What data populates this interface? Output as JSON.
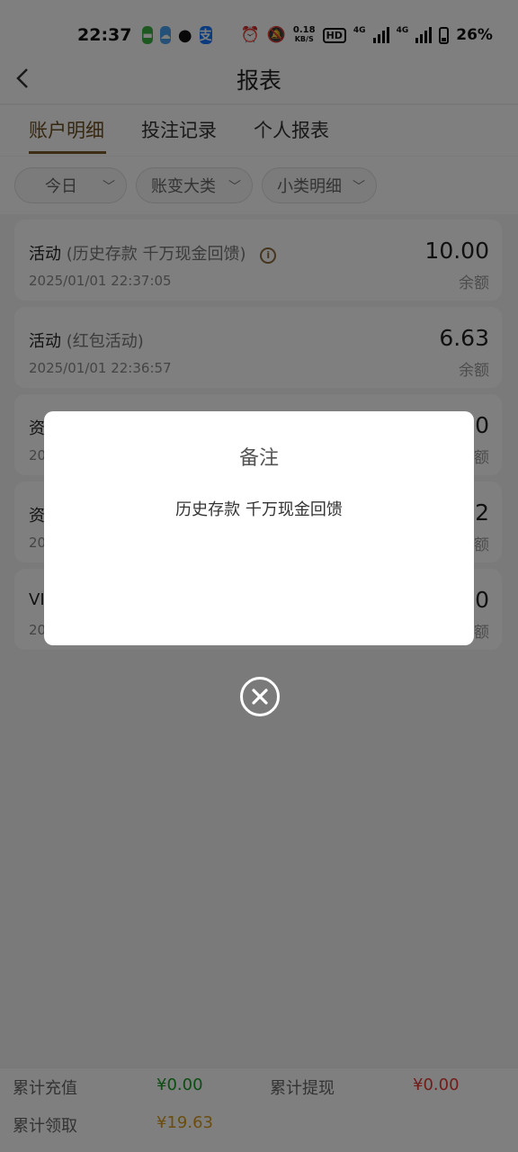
{
  "status_bar": {
    "time": "22:37",
    "net_speed_value": "0.18",
    "net_speed_unit": "KB/S",
    "hd_label": "HD",
    "network1": "4G",
    "network2": "4G",
    "battery": "26%",
    "icons": [
      "message-app-icon",
      "weather-app-icon",
      "wechat-icon",
      "alipay-icon",
      "alarm-icon",
      "mute-icon",
      "signal-icon",
      "battery-icon"
    ]
  },
  "nav": {
    "back_icon": "chevron-left-icon",
    "title": "报表"
  },
  "tabs": [
    {
      "label": "账户明细",
      "active": true
    },
    {
      "label": "投注记录",
      "active": false
    },
    {
      "label": "个人报表",
      "active": false
    }
  ],
  "filters": [
    {
      "label": "今日"
    },
    {
      "label": "账变大类"
    },
    {
      "label": "小类明细"
    }
  ],
  "records": [
    {
      "title": "活动",
      "sub": "(历史存款 千万现金回馈)",
      "has_info": true,
      "time": "2025/01/01 22:37:05",
      "amount": "10.00",
      "balance_label": "余额"
    },
    {
      "title": "活动",
      "sub": "(红包活动)",
      "has_info": false,
      "time": "2025/01/01 22:36:57",
      "amount": "6.63",
      "balance_label": "余额"
    },
    {
      "title": "资",
      "sub": "",
      "has_info": false,
      "time": "20",
      "amount": "0",
      "balance_label": "额"
    },
    {
      "title": "资",
      "sub": "",
      "has_info": false,
      "time": "20",
      "amount": "2",
      "balance_label": "额"
    },
    {
      "title": "VI",
      "sub": "",
      "has_info": false,
      "time": "20",
      "amount": "0",
      "balance_label": "额"
    }
  ],
  "footer": {
    "recharge_label": "累计充值",
    "recharge_value": "¥0.00",
    "withdraw_label": "累计提现",
    "withdraw_value": "¥0.00",
    "claim_label": "累计领取",
    "claim_value": "¥19.63"
  },
  "modal": {
    "title": "备注",
    "body": "历史存款 千万现金回馈",
    "close_icon": "close-circle-icon"
  },
  "colors": {
    "accent": "#7d5a2a",
    "green": "#1a9b28",
    "red": "#e53935",
    "gold": "#d99a1a"
  }
}
